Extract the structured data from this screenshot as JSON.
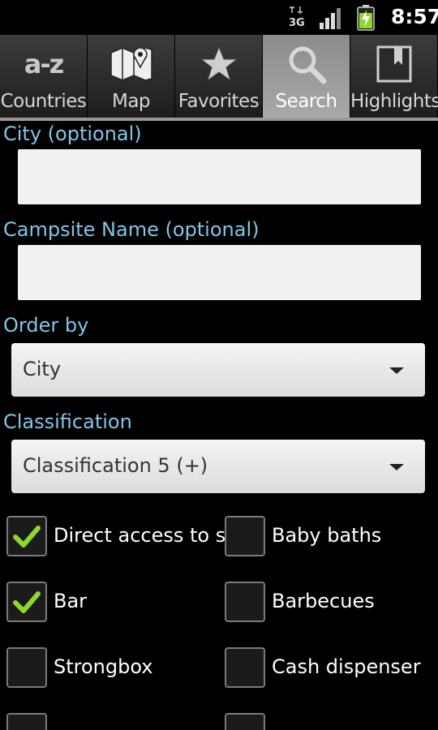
{
  "status_bar": {
    "network": "3G",
    "time": "8:57"
  },
  "tabs": [
    {
      "id": "countries",
      "label": "Countries",
      "icon": "az-icon",
      "icon_text": "a-z",
      "active": false
    },
    {
      "id": "map",
      "label": "Map",
      "icon": "map-icon",
      "active": false
    },
    {
      "id": "favorites",
      "label": "Favorites",
      "icon": "star-icon",
      "active": false
    },
    {
      "id": "search",
      "label": "Search",
      "icon": "search-icon",
      "active": true
    },
    {
      "id": "highlights",
      "label": "Highlights",
      "icon": "bookmark-icon",
      "active": false
    }
  ],
  "form": {
    "city_label": "City (optional)",
    "city_value": "",
    "campsite_label": "Campsite Name (optional)",
    "campsite_value": "",
    "order_label": "Order by",
    "order_value": "City",
    "classification_label": "Classification",
    "classification_value": "Classification 5 (+)"
  },
  "facilities": [
    {
      "label": "Direct access to sea",
      "checked": true
    },
    {
      "label": "Baby baths",
      "checked": false
    },
    {
      "label": "Bar",
      "checked": true
    },
    {
      "label": "Barbecues",
      "checked": false
    },
    {
      "label": "Strongbox",
      "checked": false
    },
    {
      "label": "Cash dispenser",
      "checked": false
    },
    {
      "label": "",
      "checked": false
    },
    {
      "label": "",
      "checked": false
    }
  ],
  "colors": {
    "section_label": "#7fc8e4",
    "check_tick": "#8ed82a",
    "background": "#000000"
  }
}
